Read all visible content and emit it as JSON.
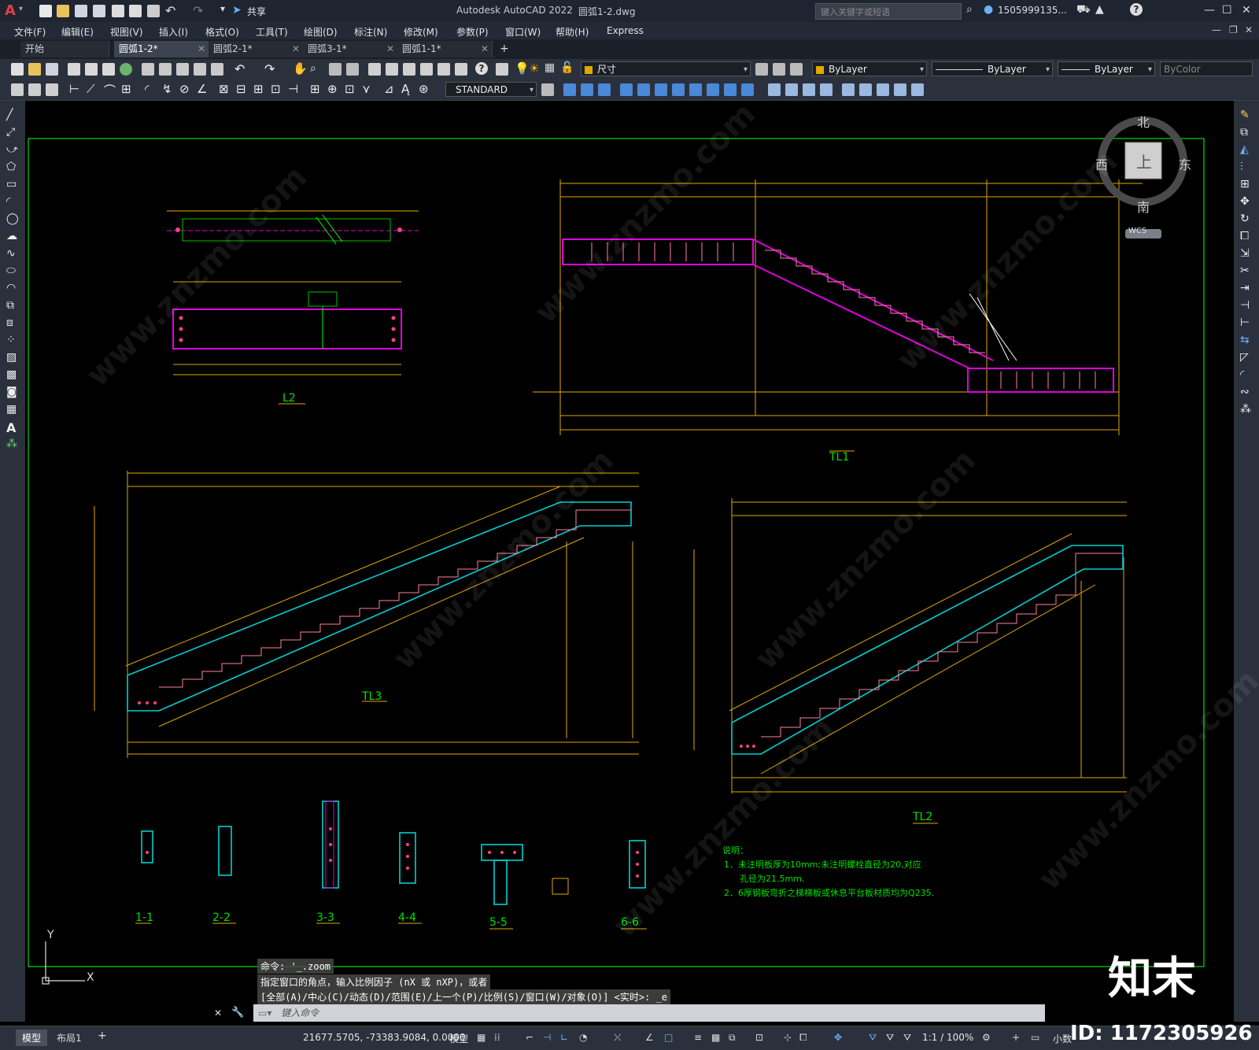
{
  "app": {
    "title": "Autodesk AutoCAD 2022",
    "document": "圆弧1-2.dwg",
    "share_label": "共享",
    "search_placeholder": "键入关键字或短语",
    "user": "1505999135...",
    "logo_letter": "A"
  },
  "menu": [
    "文件(F)",
    "编辑(E)",
    "视图(V)",
    "插入(I)",
    "格式(O)",
    "工具(T)",
    "绘图(D)",
    "标注(N)",
    "修改(M)",
    "参数(P)",
    "窗口(W)",
    "帮助(H)",
    "Express"
  ],
  "tabs": [
    {
      "label": "开始"
    },
    {
      "label": "圆弧1-2*"
    },
    {
      "label": "圆弧2-1*"
    },
    {
      "label": "圆弧3-1*"
    },
    {
      "label": "圆弧1-1*"
    }
  ],
  "toolbar": {
    "layer": "尺寸",
    "color": "ByLayer",
    "linetype": "ByLayer",
    "lineweight": "ByLayer",
    "plotstyle": "ByColor",
    "textstyle": "STANDARD"
  },
  "viewcube": {
    "north": "北",
    "south": "南",
    "east": "东",
    "west": "西",
    "top": "上",
    "wcs": "WCS"
  },
  "drawing": {
    "titles": [
      "L2",
      "TL1",
      "TL3",
      "TL2",
      "1-1",
      "2-2",
      "3-3",
      "4-4",
      "5-5",
      "6-6"
    ],
    "notes_title": "说明：",
    "notes": [
      "1．未注明板厚为10mm;未注明螺栓直径为20,对应",
      "孔径为21.5mm.",
      "2．6厚钢板弯折之梯梯板或休息平台板材质均为Q235."
    ],
    "ucs_y": "Y",
    "ucs_x": "X"
  },
  "command": {
    "lines": [
      "命令: '_.zoom",
      "指定窗口的角点，输入比例因子 (nX 或 nXP)，或者",
      "[全部(A)/中心(C)/动态(D)/范围(E)/上一个(P)/比例(S)/窗口(W)/对象(O)] <实时>: _e"
    ],
    "placeholder": "键入命令"
  },
  "status": {
    "model_tab": "模型",
    "layout_tab": "布局1",
    "coords": "21677.5705, -73383.9084, 0.0000",
    "space": "模型",
    "scale": "1:1 / 100%",
    "units": "小数"
  },
  "branding": {
    "logo": "知末",
    "id": "ID: 1172305926"
  }
}
